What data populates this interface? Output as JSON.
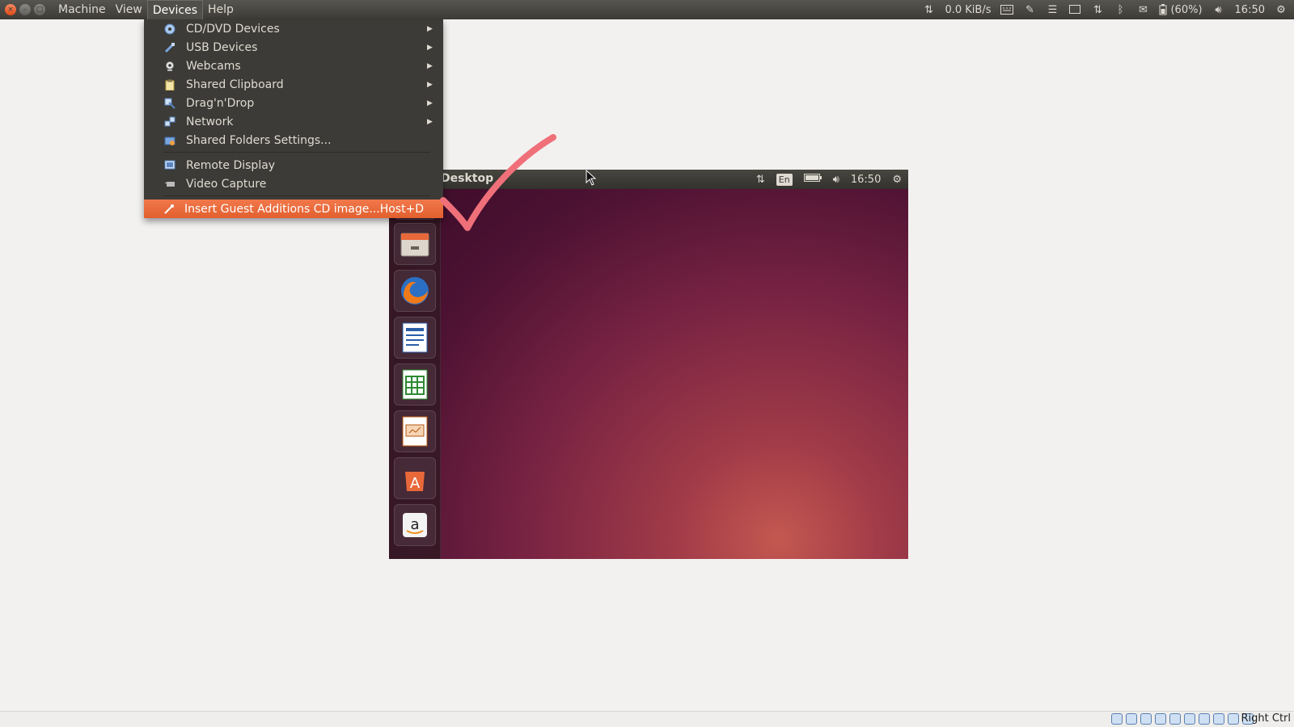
{
  "window_buttons": {
    "close": "×",
    "minimize": "–",
    "maximize": "□"
  },
  "menubar": [
    {
      "label": "Machine"
    },
    {
      "label": "View"
    },
    {
      "label": "Devices"
    },
    {
      "label": "Help"
    }
  ],
  "indicators": {
    "network_speed": "0.0 KiB/s",
    "battery": "(60%)",
    "time": "16:50"
  },
  "devices_menu": [
    {
      "label": "CD/DVD Devices",
      "icon": "cd-icon",
      "submenu": true
    },
    {
      "label": "USB Devices",
      "icon": "usb-icon",
      "submenu": true
    },
    {
      "label": "Webcams",
      "icon": "webcam-icon",
      "submenu": true
    },
    {
      "label": "Shared Clipboard",
      "icon": "clipboard-icon",
      "submenu": true
    },
    {
      "label": "Drag'n'Drop",
      "icon": "drag-drop-icon",
      "submenu": true
    },
    {
      "label": "Network",
      "icon": "network-icon",
      "submenu": true
    },
    {
      "label": "Shared Folders Settings...",
      "icon": "shared-folders-icon",
      "submenu": false
    },
    {
      "label": "Remote Display",
      "icon": "remote-display-icon",
      "submenu": false
    },
    {
      "label": "Video Capture",
      "icon": "video-capture-icon",
      "submenu": false
    },
    {
      "label": "Insert Guest Additions CD image...",
      "shortcut": "Host+D",
      "icon": "guest-additions-icon",
      "submenu": false,
      "highlighted": true
    }
  ],
  "guest": {
    "title": "Desktop",
    "lang": "En",
    "time": "16:50",
    "launcher_apps": [
      "ubuntu-software-icon",
      "files-icon",
      "firefox-icon",
      "writer-icon",
      "calc-icon",
      "impress-icon",
      "software-center-icon",
      "amazon-icon"
    ]
  },
  "statusbar": {
    "host_key": "Right Ctrl"
  },
  "colors": {
    "highlight": "#e9683a",
    "menu_bg": "#3c3b37",
    "checkmark": "#f0707a"
  }
}
